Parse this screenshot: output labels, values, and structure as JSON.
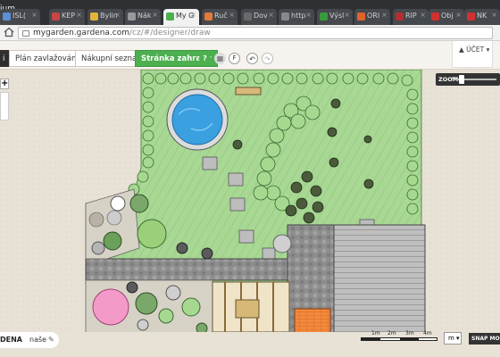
{
  "browser": {
    "app_title": "ium",
    "tabs": [
      {
        "label": "ISL(",
        "color": "#5b8fd6"
      },
      {
        "label": "KEP",
        "color": "#c74545"
      },
      {
        "label": "Bylin",
        "color": "#e0b43c"
      },
      {
        "label": "Nák",
        "color": "#999999"
      },
      {
        "label": "My G",
        "color": "#4caf50"
      },
      {
        "label": "Ruč",
        "color": "#e07b39"
      },
      {
        "label": "Dov",
        "color": "#6a6a6a"
      },
      {
        "label": "http",
        "color": "#888888"
      },
      {
        "label": "Výsl",
        "color": "#3a9a3a"
      },
      {
        "label": "ORI",
        "color": "#e0632b"
      },
      {
        "label": "RIP",
        "color": "#b03030"
      },
      {
        "label": "Obj",
        "color": "#d23030"
      },
      {
        "label": "NK",
        "color": "#d23030"
      }
    ],
    "url": "mygarden.gardena.com",
    "url_path": "/cz/#/designer/draw"
  },
  "header": {
    "nav": [
      {
        "label": "i"
      },
      {
        "label": "Plán zavlažování"
      },
      {
        "label": "Nákupní seznam"
      },
      {
        "label": "Stránka zahrady"
      }
    ],
    "tools": {
      "help": "?",
      "grid": "▦",
      "flag": "F",
      "undo": "↶",
      "redo": "↷"
    },
    "account_label": "ÚČET"
  },
  "zoom": {
    "label": "ZOOM",
    "minus": "−",
    "level": 0.1
  },
  "left": {
    "plus": "+"
  },
  "footer": {
    "brand": "DENA",
    "project": "naše",
    "unit": "m",
    "snap": "SNAP MODE",
    "scale_ticks": [
      "1m",
      "2m",
      "3m",
      "4m"
    ]
  },
  "colors": {
    "lawn": "#9fd08a",
    "lawn_dark": "#7fbd6c",
    "path": "#9a9a9a",
    "pond": "#3aa0e0",
    "accent_green": "#4caf50"
  }
}
